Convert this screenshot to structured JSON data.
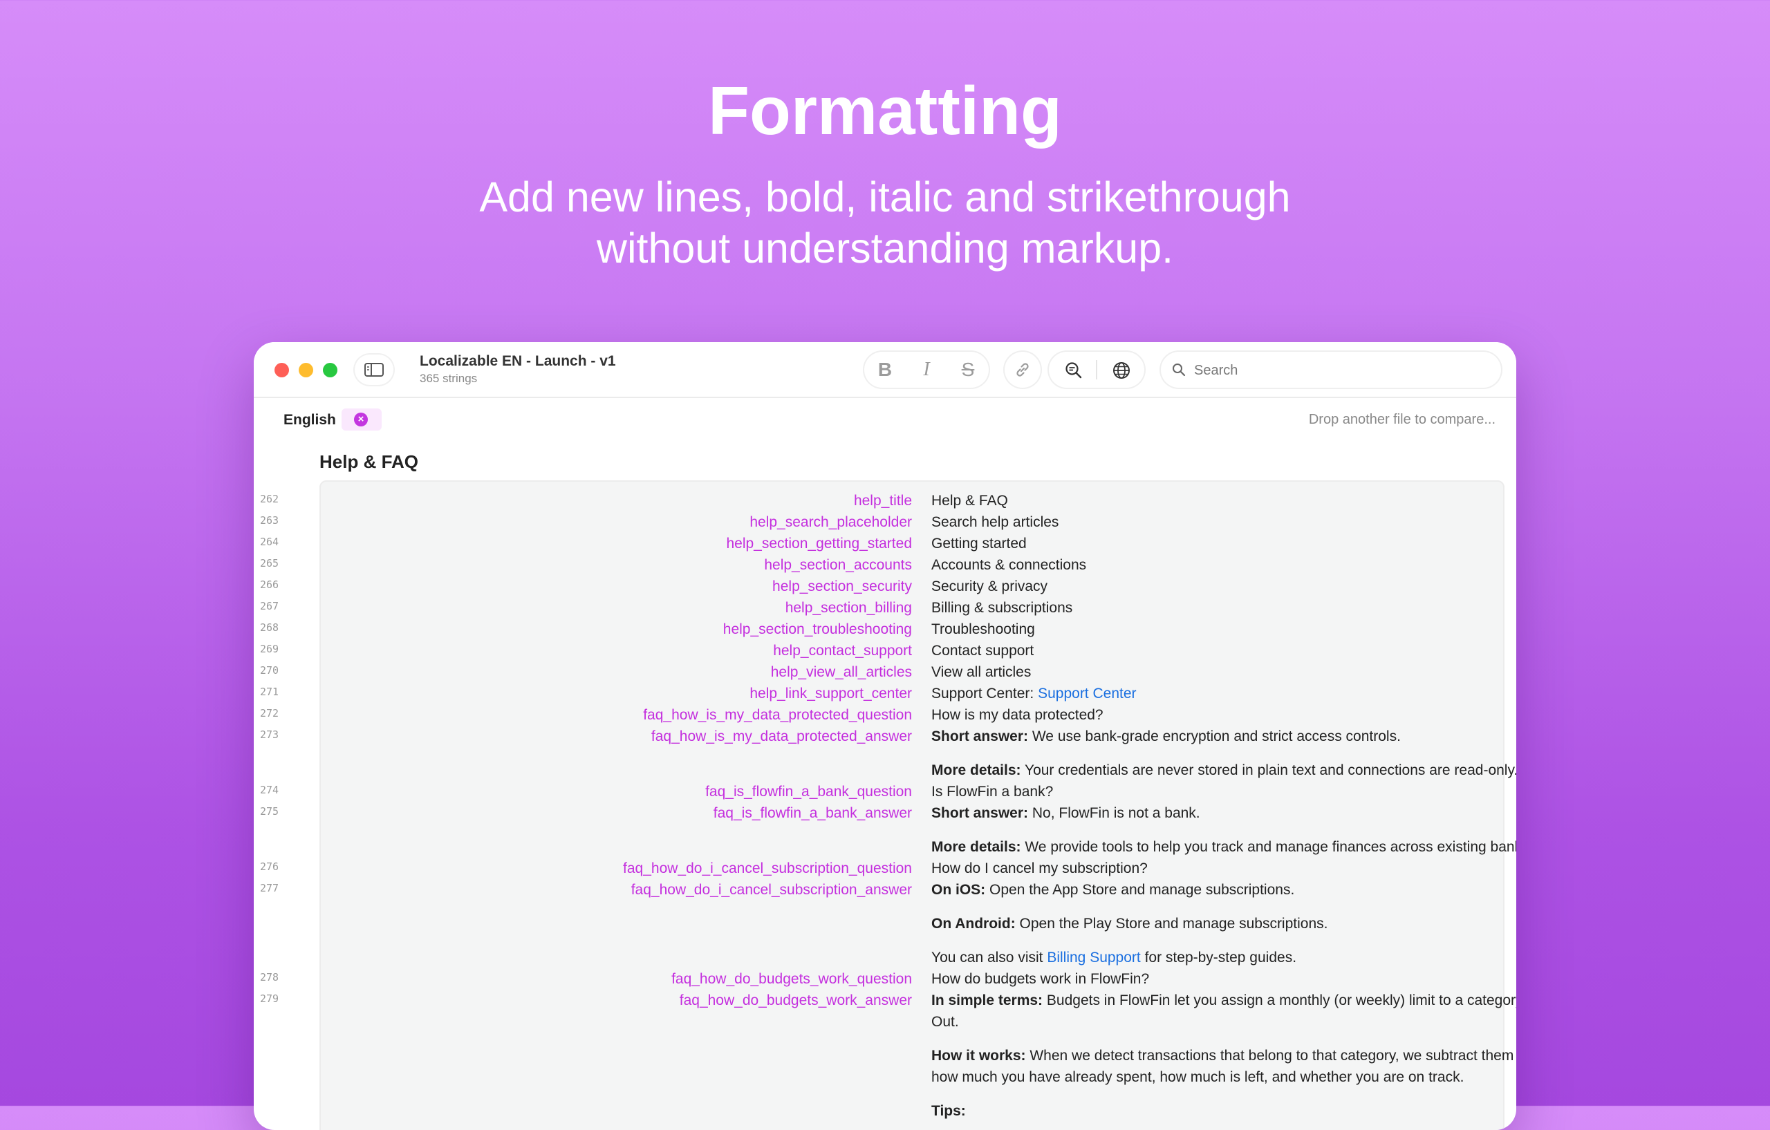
{
  "hero": {
    "title": "Formatting",
    "subtitle_line1": "Add new lines, bold, italic and strikethrough",
    "subtitle_line2": "without understanding markup."
  },
  "window": {
    "doc_title": "Localizable EN - Launch - v1",
    "doc_subtitle": "365 strings",
    "toolbar": {
      "bold": "B",
      "italic": "I",
      "strike": "S"
    },
    "search_placeholder": "Search"
  },
  "language_bar": {
    "language": "English",
    "remove_glyph": "×",
    "drop_hint": "Drop another file to compare..."
  },
  "section_title": "Help & FAQ",
  "colors": {
    "key": "#c42fde",
    "link": "#1a6fe0",
    "background_top": "#d68cf9",
    "background_bottom": "#a548df"
  },
  "rows": [
    {
      "line": "262",
      "key": "help_title",
      "value": [
        [
          {
            "t": "Help & FAQ"
          }
        ]
      ]
    },
    {
      "line": "263",
      "key": "help_search_placeholder",
      "value": [
        [
          {
            "t": "Search help articles"
          }
        ]
      ]
    },
    {
      "line": "264",
      "key": "help_section_getting_started",
      "value": [
        [
          {
            "t": "Getting started"
          }
        ]
      ]
    },
    {
      "line": "265",
      "key": "help_section_accounts",
      "value": [
        [
          {
            "t": "Accounts & connections"
          }
        ]
      ]
    },
    {
      "line": "266",
      "key": "help_section_security",
      "value": [
        [
          {
            "t": "Security & privacy"
          }
        ]
      ]
    },
    {
      "line": "267",
      "key": "help_section_billing",
      "value": [
        [
          {
            "t": "Billing & subscriptions"
          }
        ]
      ]
    },
    {
      "line": "268",
      "key": "help_section_troubleshooting",
      "value": [
        [
          {
            "t": "Troubleshooting"
          }
        ]
      ]
    },
    {
      "line": "269",
      "key": "help_contact_support",
      "value": [
        [
          {
            "t": "Contact support"
          }
        ]
      ]
    },
    {
      "line": "270",
      "key": "help_view_all_articles",
      "value": [
        [
          {
            "t": "View all articles"
          }
        ]
      ]
    },
    {
      "line": "271",
      "key": "help_link_support_center",
      "value": [
        [
          {
            "t": "Support Center: "
          },
          {
            "t": "Support Center",
            "link": true
          }
        ]
      ]
    },
    {
      "line": "272",
      "key": "faq_how_is_my_data_protected_question",
      "value": [
        [
          {
            "t": "How is my data protected?"
          }
        ]
      ]
    },
    {
      "line": "273",
      "key": "faq_how_is_my_data_protected_answer",
      "value": [
        [
          {
            "t": "Short answer:",
            "b": true
          },
          {
            "t": " We use bank-grade encryption and strict access controls."
          }
        ],
        [
          {
            "t": "More details:",
            "b": true
          },
          {
            "t": " Your credentials are never stored in plain text and connections are read-only."
          }
        ]
      ]
    },
    {
      "line": "274",
      "key": "faq_is_flowfin_a_bank_question",
      "value": [
        [
          {
            "t": "Is FlowFin a bank?"
          }
        ]
      ]
    },
    {
      "line": "275",
      "key": "faq_is_flowfin_a_bank_answer",
      "value": [
        [
          {
            "t": "Short answer:",
            "b": true
          },
          {
            "t": " No, FlowFin is not a bank."
          }
        ],
        [
          {
            "t": "More details:",
            "b": true
          },
          {
            "t": " We provide tools to help you track and manage finances across existing banks and institutions."
          }
        ]
      ]
    },
    {
      "line": "276",
      "key": "faq_how_do_i_cancel_subscription_question",
      "value": [
        [
          {
            "t": "How do I cancel my subscription?"
          }
        ]
      ]
    },
    {
      "line": "277",
      "key": "faq_how_do_i_cancel_subscription_answer",
      "value": [
        [
          {
            "t": "On iOS:",
            "b": true
          },
          {
            "t": " Open the App Store and manage subscriptions."
          }
        ],
        [
          {
            "t": "On Android:",
            "b": true
          },
          {
            "t": " Open the Play Store and manage subscriptions."
          }
        ],
        [
          {
            "t": "You can also visit "
          },
          {
            "t": "Billing Support",
            "link": true
          },
          {
            "t": " for step-by-step guides."
          }
        ]
      ]
    },
    {
      "line": "278",
      "key": "faq_how_do_budgets_work_question",
      "value": [
        [
          {
            "t": "How do budgets work in FlowFin?"
          }
        ]
      ]
    },
    {
      "line": "279",
      "key": "faq_how_do_budgets_work_answer",
      "value": [
        [
          {
            "t": "In simple terms:",
            "b": true
          },
          {
            "t": " Budgets in FlowFin let you assign a monthly (or weekly) limit to a category, such as Groceries or Eating Out."
          }
        ],
        [
          {
            "t": "How it works:",
            "b": true
          },
          {
            "t": " When we detect transactions that belong to that category, we subtract them from your budget. You can see how much you have already spent, how much is left, and whether you are on track."
          }
        ],
        [
          {
            "t": "Tips:",
            "b": true
          }
        ]
      ]
    }
  ]
}
